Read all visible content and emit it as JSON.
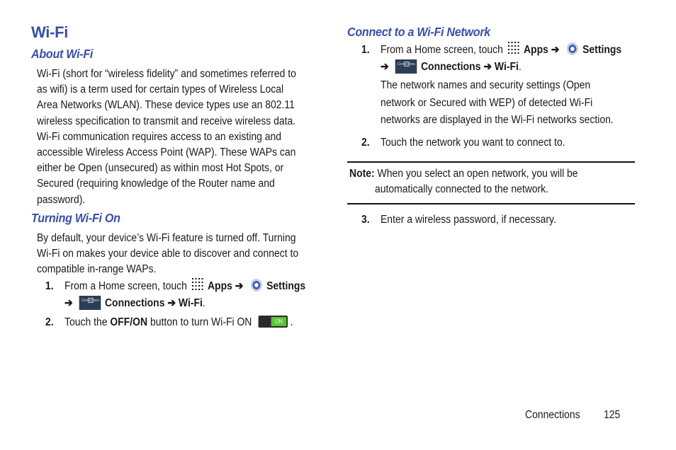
{
  "left": {
    "title": "Wi-Fi",
    "about": {
      "heading": "About Wi-Fi",
      "lines": [
        "Wi-Fi (short for “wireless fidelity” and sometimes referred to",
        "as wifi) is a term used for certain types of Wireless Local",
        "Area Networks (WLAN). These device types use an 802.11",
        "wireless specification to transmit and receive wireless data.",
        "Wi-Fi communication requires access to an existing and",
        "accessible Wireless Access Point (WAP). These WAPs can",
        "either be Open (unsecured) as within most Hot Spots, or",
        "Secured (requiring knowledge of the Router name and",
        "password)."
      ]
    },
    "turning_on": {
      "heading": "Turning Wi-Fi On",
      "lines": [
        "By default, your device’s Wi-Fi feature is turned off. Turning",
        "Wi-Fi on makes your device able to discover and connect to",
        "compatible in-range WAPs."
      ],
      "step1": {
        "num": "1.",
        "text_a": "From a Home screen, touch",
        "apps": "Apps",
        "arrow": "➔",
        "settings": "Settings",
        "connections_icon_label": "Connections",
        "connections": "Connections",
        "wifi": "Wi-Fi",
        "period": "."
      },
      "step2": {
        "num": "2.",
        "text_a": "Touch the",
        "button": "OFF/ON",
        "text_b": "button to turn Wi-Fi ON",
        "toggle_label": "ON",
        "period": "."
      }
    }
  },
  "right": {
    "heading": "Connect to a Wi-Fi Network",
    "step1": {
      "num": "1.",
      "text_a": "From a Home screen, touch",
      "apps": "Apps",
      "arrow": "➔",
      "settings": "Settings",
      "connections_icon_label": "Connections",
      "connections": "Connections",
      "wifi": "Wi-Fi",
      "period": ".",
      "detail_lines": [
        "The network names and security settings (Open",
        "network or Secured with WEP) of detected Wi-Fi",
        "networks are displayed in the Wi-Fi networks section."
      ]
    },
    "step2": {
      "num": "2.",
      "text": "Touch the network you want to connect to."
    },
    "note": {
      "label": "Note:",
      "line1": "When you select an open network, you will be",
      "line2": "automatically connected to the network."
    },
    "step3": {
      "num": "3.",
      "text": "Enter a wireless password, if necessary."
    }
  },
  "footer": {
    "section": "Connections",
    "page": "125"
  }
}
